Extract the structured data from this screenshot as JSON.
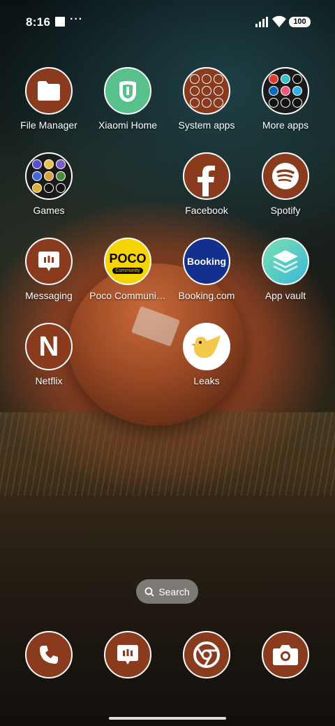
{
  "status_bar": {
    "time": "8:16",
    "notification_dots": "···",
    "battery": "100"
  },
  "apps": [
    {
      "id": "file-manager",
      "label": "File Manager"
    },
    {
      "id": "xiaomi-home",
      "label": "Xiaomi Home"
    },
    {
      "id": "system-apps",
      "label": "System apps"
    },
    {
      "id": "more-apps",
      "label": "More apps"
    },
    {
      "id": "games",
      "label": "Games"
    },
    {
      "id": "facebook",
      "label": "Facebook"
    },
    {
      "id": "spotify",
      "label": "Spotify"
    },
    {
      "id": "messaging",
      "label": "Messaging"
    },
    {
      "id": "poco-community",
      "label": "Poco Communi…",
      "icon_text": "POCO",
      "icon_subtext": "Community"
    },
    {
      "id": "booking",
      "label": "Booking.com",
      "icon_text": "Booking"
    },
    {
      "id": "app-vault",
      "label": "App vault"
    },
    {
      "id": "netflix",
      "label": "Netflix",
      "icon_text": "N"
    },
    {
      "id": "leaks",
      "label": "Leaks"
    }
  ],
  "search": {
    "label": "Search"
  },
  "dock": [
    "phone",
    "messaging",
    "chrome",
    "camera"
  ],
  "colors": {
    "icon_brown": "#8a3a1d",
    "booking_blue": "#13308f",
    "poco_yellow": "#f6d400",
    "xiaomi_green": "#58c08a"
  }
}
